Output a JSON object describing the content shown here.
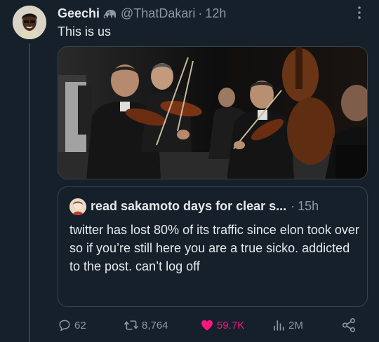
{
  "tweet": {
    "display_name": "Geechi",
    "handle": "@ThatDakari",
    "separator": "·",
    "time": "12h",
    "text": "This is us"
  },
  "icons": {
    "display_name_badge": "elephant-icon",
    "more": "more-dots-icon",
    "reply": "reply-icon",
    "retweet": "retweet-icon",
    "like": "heart-icon",
    "views": "views-chart-icon",
    "share": "share-icon"
  },
  "quote": {
    "name": "read sakamoto days for clear s...",
    "separator": "·",
    "time": "15h",
    "text": "twitter has lost 80% of its traffic since elon took over so if you’re still here you are a true sicko. addicted to the post. can’t log off"
  },
  "stats": {
    "replies": "62",
    "retweets": "8,764",
    "likes": "59.7K",
    "views": "2M"
  },
  "colors": {
    "background": "#15202b",
    "text": "#e7e9ea",
    "secondary": "#8b98a5",
    "border": "#38444d",
    "like": "#f91880"
  }
}
